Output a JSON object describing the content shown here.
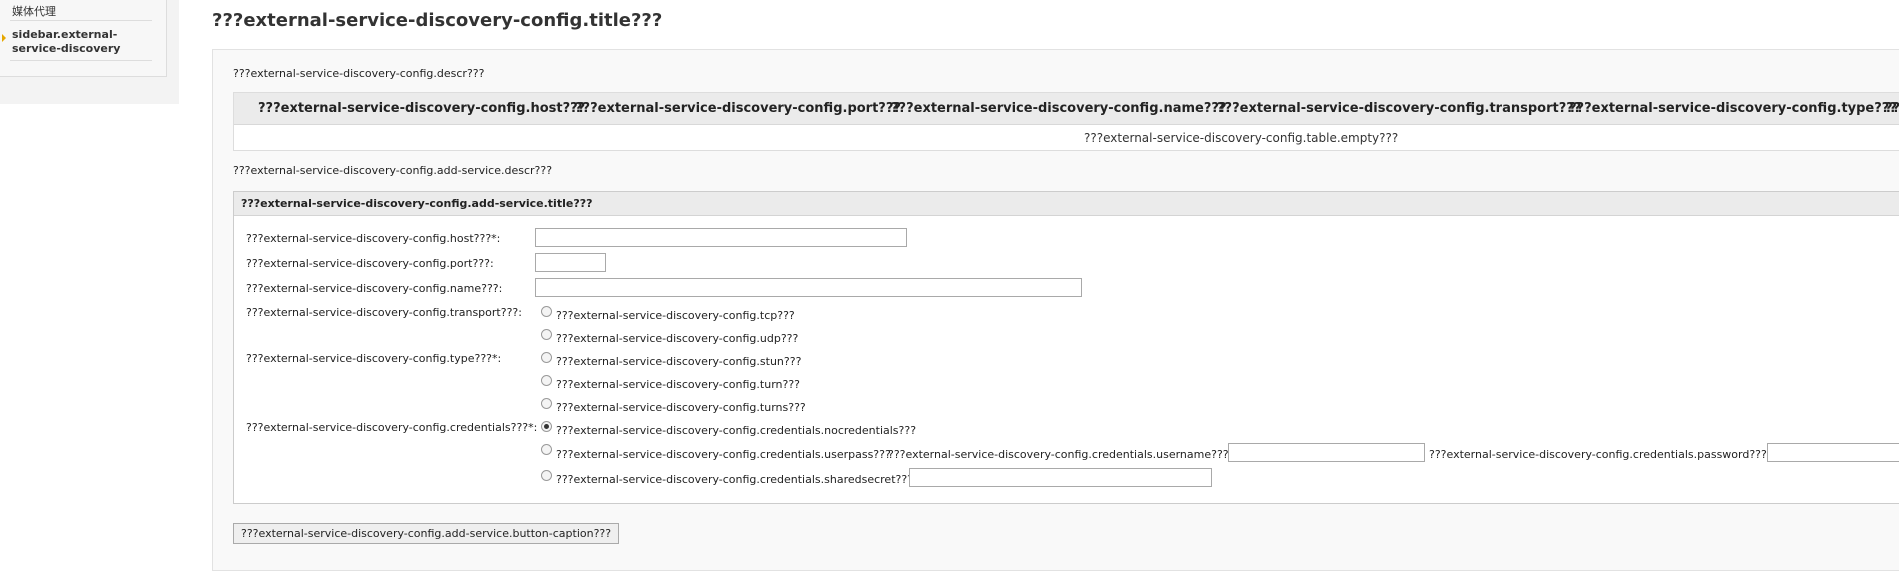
{
  "sidebar": {
    "items": [
      {
        "label": "媒体代理"
      },
      {
        "label": "sidebar.external-service-discovery"
      }
    ]
  },
  "page": {
    "title": "???external-service-discovery-config.title???",
    "descr": "???external-service-discovery-config.descr???"
  },
  "table": {
    "columns": [
      "???external-service-discovery-config.host???",
      "???external-service-discovery-config.port???",
      "???external-service-discovery-config.name???",
      "???external-service-discovery-config.transport???",
      "???external-service-discovery-config.type???",
      "???"
    ],
    "empty": "???external-service-discovery-config.table.empty???"
  },
  "add_service": {
    "descr": "???external-service-discovery-config.add-service.descr???",
    "title": "???external-service-discovery-config.add-service.title???",
    "host_label": "???external-service-discovery-config.host???*:",
    "port_label": "???external-service-discovery-config.port???:",
    "name_label": "???external-service-discovery-config.name???:",
    "transport_label": "???external-service-discovery-config.transport???:",
    "transport_options": [
      "???external-service-discovery-config.tcp???",
      "???external-service-discovery-config.udp???"
    ],
    "type_label": "???external-service-discovery-config.type???*:",
    "type_options": [
      "???external-service-discovery-config.stun???",
      "???external-service-discovery-config.turn???",
      "???external-service-discovery-config.turns???"
    ],
    "credentials_label": "???external-service-discovery-config.credentials???*:",
    "credentials_options": [
      "???external-service-discovery-config.credentials.nocredentials???",
      "???external-service-discovery-config.credentials.userpass???",
      "???external-service-discovery-config.credentials.sharedsecret???"
    ],
    "username_label": "???external-service-discovery-config.credentials.username???:",
    "password_label": "???external-service-discovery-config.credentials.password???:",
    "button_caption": "???external-service-discovery-config.add-service.button-caption???"
  }
}
